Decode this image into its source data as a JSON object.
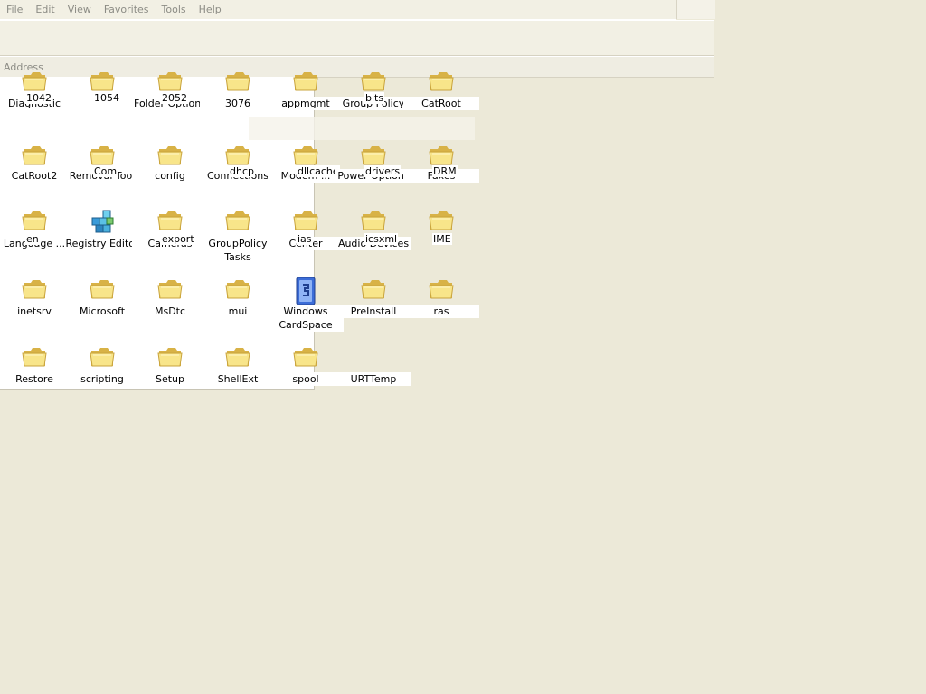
{
  "menu": [
    "File",
    "Edit",
    "View",
    "Favorites",
    "Tools",
    "Help"
  ],
  "address": {
    "label": "Address"
  },
  "items": [
    {
      "label": "Diagnostic",
      "overlay": "1042",
      "row": 0,
      "col": 0,
      "icon": "folder-icon"
    },
    {
      "label": "",
      "overlay": "1054",
      "row": 0,
      "col": 1,
      "icon": "folder-icon"
    },
    {
      "label": "Folder Options",
      "overlay": "2052",
      "row": 0,
      "col": 2,
      "icon": "folder-icon"
    },
    {
      "label": "3076",
      "overlay": "",
      "row": 0,
      "col": 3,
      "icon": "folder-icon"
    },
    {
      "label": "appmgmt",
      "overlay": "",
      "row": 0,
      "col": 4,
      "icon": "folder-icon"
    },
    {
      "label": "Group Policy",
      "overlay": "bits",
      "row": 0,
      "col": 5,
      "icon": "folder-icon"
    },
    {
      "label": "CatRoot",
      "overlay": "",
      "row": 0,
      "col": 6,
      "icon": "folder-icon"
    },
    {
      "label": "CatRoot2",
      "overlay": "",
      "row": 1,
      "col": 0,
      "icon": "folder-icon"
    },
    {
      "label": "Removal Tool",
      "overlay": "Com",
      "row": 1,
      "col": 1,
      "icon": "folder-icon"
    },
    {
      "label": "config",
      "overlay": "",
      "row": 1,
      "col": 2,
      "icon": "folder-icon"
    },
    {
      "label": "Connections",
      "overlay": "dhcp",
      "row": 1,
      "col": 3,
      "icon": "folder-icon"
    },
    {
      "label": "Modem ...",
      "overlay": "dllcache",
      "row": 1,
      "col": 4,
      "icon": "folder-icon"
    },
    {
      "label": "Power Options",
      "overlay": "drivers",
      "row": 1,
      "col": 5,
      "icon": "folder-icon"
    },
    {
      "label": "Faxes",
      "overlay": "DRM",
      "row": 1,
      "col": 6,
      "icon": "folder-icon"
    },
    {
      "label": "Language ...",
      "overlay": "en",
      "row": 2,
      "col": 0,
      "icon": "folder-icon"
    },
    {
      "label": "Registry Editor",
      "overlay": "",
      "row": 2,
      "col": 1,
      "icon": "registry-editor-icon"
    },
    {
      "label": "Cameras",
      "overlay": "export",
      "row": 2,
      "col": 2,
      "icon": "folder-icon"
    },
    {
      "label": "GroupPolicy Tasks",
      "overlay": "",
      "row": 2,
      "col": 3,
      "icon": "folder-icon"
    },
    {
      "label": "Center",
      "overlay": "ias",
      "row": 2,
      "col": 4,
      "icon": "folder-icon"
    },
    {
      "label": "Audio Devices",
      "overlay": "icsxml",
      "row": 2,
      "col": 5,
      "icon": "folder-icon"
    },
    {
      "label": "",
      "overlay": "IME",
      "row": 2,
      "col": 6,
      "icon": "folder-icon"
    },
    {
      "label": "inetsrv",
      "overlay": "",
      "row": 3,
      "col": 0,
      "icon": "folder-icon"
    },
    {
      "label": "Microsoft",
      "overlay": "",
      "row": 3,
      "col": 1,
      "icon": "folder-icon"
    },
    {
      "label": "MsDtc",
      "overlay": "",
      "row": 3,
      "col": 2,
      "icon": "folder-icon"
    },
    {
      "label": "mui",
      "overlay": "",
      "row": 3,
      "col": 3,
      "icon": "folder-icon"
    },
    {
      "label": "Windows CardSpace",
      "overlay": "",
      "row": 3,
      "col": 4,
      "icon": "cardspace-icon"
    },
    {
      "label": "PreInstall",
      "overlay": "",
      "row": 3,
      "col": 5,
      "icon": "folder-icon"
    },
    {
      "label": "ras",
      "overlay": "",
      "row": 3,
      "col": 6,
      "icon": "folder-icon"
    },
    {
      "label": "Restore",
      "overlay": "",
      "row": 4,
      "col": 0,
      "icon": "folder-icon"
    },
    {
      "label": "scripting",
      "overlay": "",
      "row": 4,
      "col": 1,
      "icon": "folder-icon"
    },
    {
      "label": "Setup",
      "overlay": "",
      "row": 4,
      "col": 2,
      "icon": "folder-icon"
    },
    {
      "label": "ShellExt",
      "overlay": "",
      "row": 4,
      "col": 3,
      "icon": "folder-icon"
    },
    {
      "label": "spool",
      "overlay": "",
      "row": 4,
      "col": 4,
      "icon": "folder-icon"
    },
    {
      "label": "URTTemp",
      "overlay": "",
      "row": 4,
      "col": 5,
      "icon": "none"
    }
  ],
  "colors": {
    "window_bg": "#ECE9D8",
    "menu_text": "#8C8C85",
    "folder_fill": "#F8E58A",
    "folder_dark": "#D8B246"
  }
}
